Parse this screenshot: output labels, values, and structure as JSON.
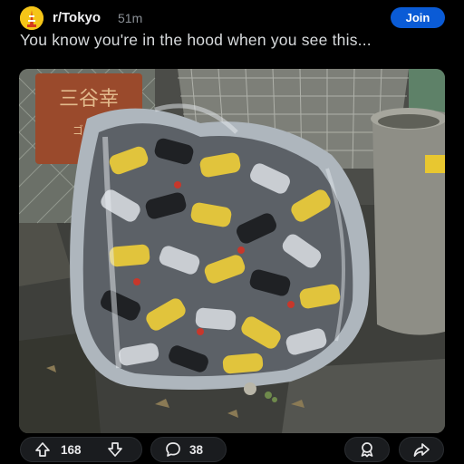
{
  "post": {
    "subreddit": "r/Tokyo",
    "age": "51m",
    "join_label": "Join",
    "title": "You know you're in the hood when you see this..."
  },
  "image": {
    "sign_text": "三谷幸",
    "sign_subtext": "ゴミ箱"
  },
  "actions": {
    "upvotes": "168",
    "comments": "38"
  },
  "colors": {
    "background": "#000000",
    "join_button": "#0a5bd6",
    "avatar": "#f5c518"
  },
  "icons": {
    "upvote": "arrow-up-icon",
    "downvote": "arrow-down-icon",
    "comment": "comment-bubble-icon",
    "award": "award-icon",
    "share": "share-arrow-icon"
  }
}
